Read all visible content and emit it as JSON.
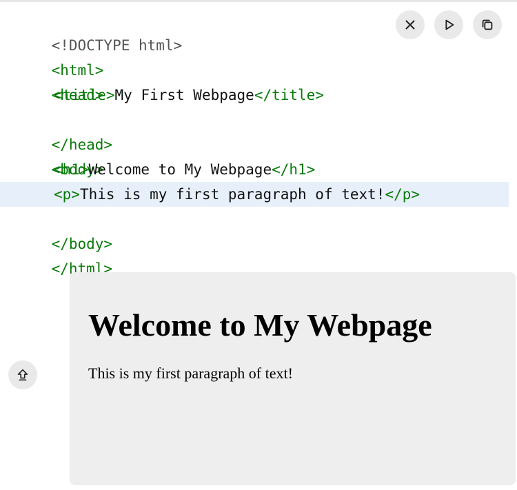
{
  "code": {
    "lines": [
      {
        "parts": [
          "<!DOCTYPE html>"
        ]
      },
      {
        "parts": [
          "<html>"
        ]
      },
      {
        "parts": [
          "<head>"
        ]
      },
      {
        "parts": [
          "<title>",
          "My First Webpage",
          "</title>"
        ]
      },
      {
        "parts": [
          "</head>"
        ]
      },
      {
        "parts": [
          "<body>"
        ]
      },
      {
        "parts": [
          "<h1>",
          "Welcome to My Webpage",
          "</h1>"
        ]
      },
      {
        "parts": [
          "<p>",
          "This is my first paragraph of text!",
          "</p>"
        ]
      },
      {
        "parts": [
          "</body>"
        ]
      },
      {
        "parts": [
          "</html>"
        ]
      }
    ]
  },
  "toolbar": {
    "close_icon": "close-icon",
    "run_icon": "play-icon",
    "copy_icon": "copy-icon"
  },
  "preview": {
    "heading": "Welcome to My Webpage",
    "paragraph": "This is my first paragraph of text!"
  },
  "share": {
    "icon": "share-upload-icon"
  },
  "colors": {
    "tag": "#0a7a0a",
    "doctype": "#555555",
    "highlight": "#e7f0fa",
    "preview_bg": "#eeeeee",
    "button_bg": "#e9e9e9"
  }
}
